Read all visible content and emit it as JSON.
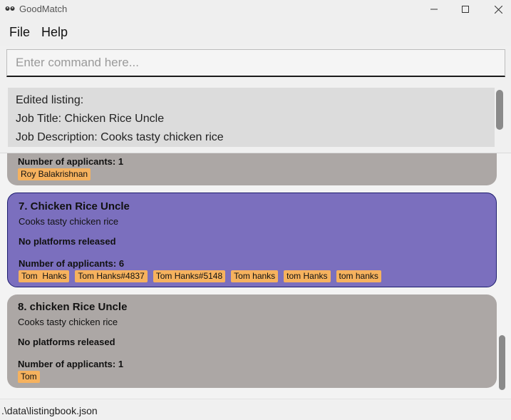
{
  "window": {
    "title": "GoodMatch",
    "controls": {
      "minimize": "—",
      "maximize": "☐",
      "close": "✕"
    }
  },
  "menu": {
    "items": [
      "File",
      "Help"
    ]
  },
  "command": {
    "placeholder": "Enter command here...",
    "value": ""
  },
  "result": {
    "lines": [
      "Edited listing:",
      "Job Title: Chicken Rice Uncle",
      "Job Description: Cooks tasty chicken rice"
    ]
  },
  "listings": [
    {
      "title": "",
      "description": "",
      "platforms": "",
      "applicants_label": "Number of applicants: 1",
      "applicants": [
        "Roy Balakrishnan"
      ]
    },
    {
      "title": "7.  Chicken Rice Uncle",
      "description": "Cooks tasty chicken rice",
      "platforms": "No platforms released",
      "applicants_label": "Number of applicants: 6",
      "applicants": [
        "Tom  Hanks",
        "Tom Hanks#4837",
        "Tom Hanks#5148",
        "Tom hanks",
        "tom Hanks",
        "tom hanks"
      ]
    },
    {
      "title": "8.  chicken Rice Uncle",
      "description": "Cooks tasty chicken rice",
      "platforms": "No platforms released",
      "applicants_label": "Number of applicants: 1",
      "applicants": [
        "Tom"
      ]
    }
  ],
  "status": {
    "path": ".\\data\\listingbook.json"
  },
  "colors": {
    "selected_card": "#7b6fbe",
    "card": "#aca7a5",
    "tag": "#f6b25e"
  }
}
